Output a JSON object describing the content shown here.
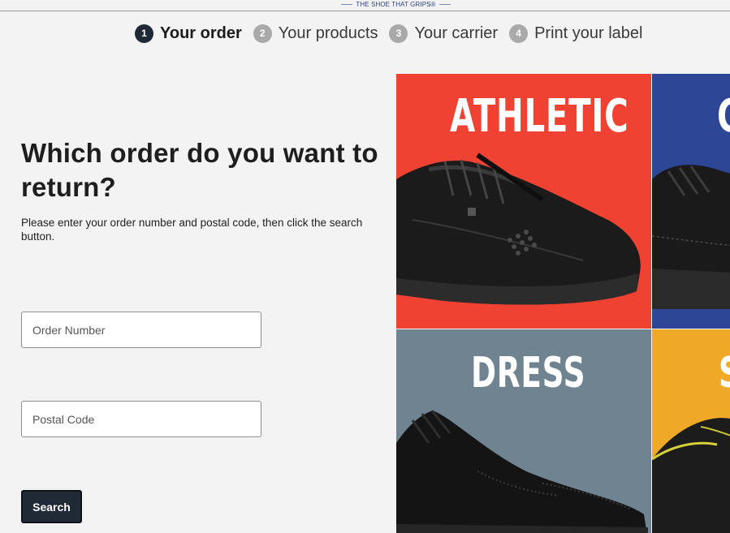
{
  "brand": {
    "tagline": "THE SHOE THAT GRIPS®"
  },
  "stepper": {
    "steps": [
      {
        "number": "1",
        "label": "Your order",
        "active": true
      },
      {
        "number": "2",
        "label": "Your products",
        "active": false
      },
      {
        "number": "3",
        "label": "Your carrier",
        "active": false
      },
      {
        "number": "4",
        "label": "Print your label",
        "active": false
      }
    ]
  },
  "form": {
    "heading": "Which order do you want to return?",
    "instructions": "Please enter your order number and postal code, then click the search button.",
    "order_number": {
      "placeholder": "Order Number",
      "value": ""
    },
    "postal_code": {
      "placeholder": "Postal Code",
      "value": ""
    },
    "search_label": "Search"
  },
  "categories": [
    {
      "title": "ATHLETIC",
      "color": "#ef4232"
    },
    {
      "title": "C",
      "color": "#2d4796"
    },
    {
      "title": "DRESS",
      "color": "#6f8391"
    },
    {
      "title": "S",
      "color": "#f0a926"
    }
  ]
}
